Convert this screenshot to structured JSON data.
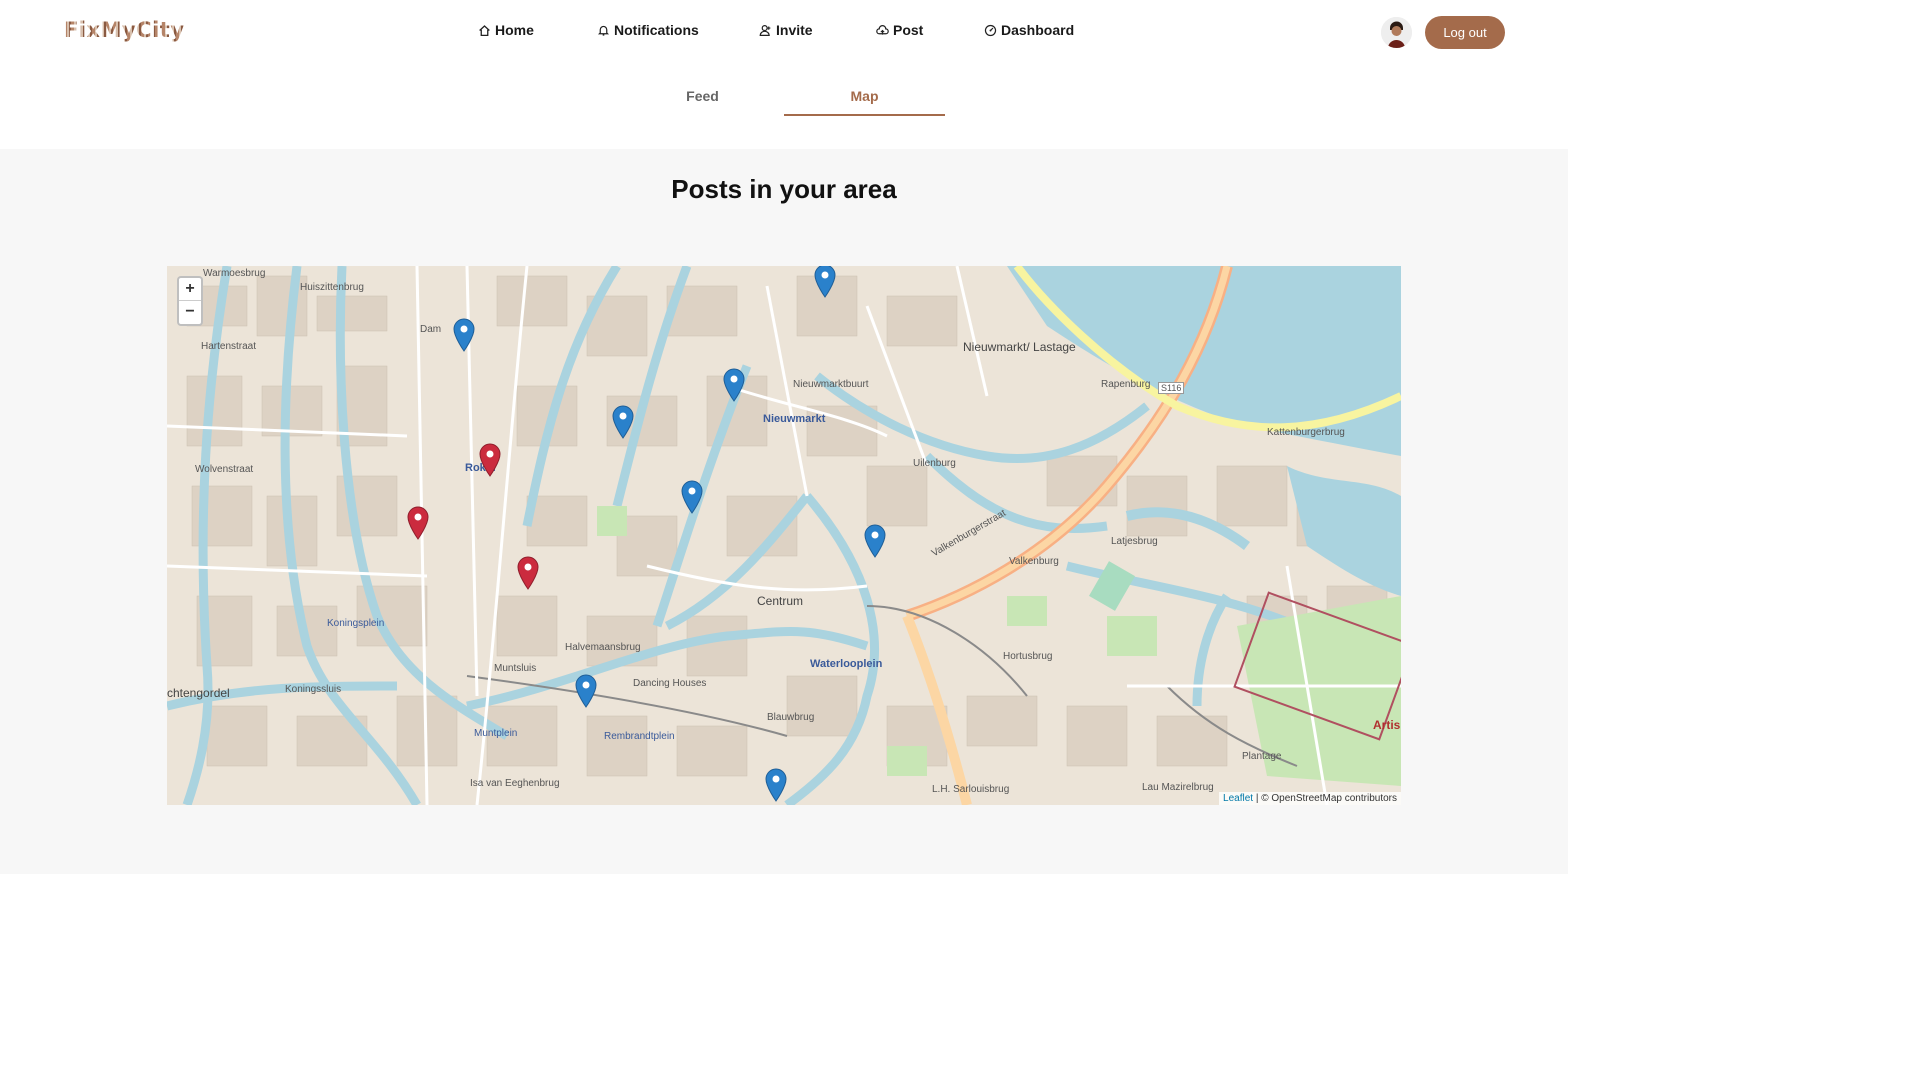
{
  "app": {
    "logo": "FixMyCity"
  },
  "nav": {
    "items": [
      {
        "label": "Home",
        "icon": "home-icon"
      },
      {
        "label": "Notifications",
        "icon": "bell-icon"
      },
      {
        "label": "Invite",
        "icon": "user-plus-icon"
      },
      {
        "label": "Post",
        "icon": "cloud-upload-icon"
      },
      {
        "label": "Dashboard",
        "icon": "dashboard-icon"
      }
    ],
    "logout": "Log out"
  },
  "tabs": {
    "feed": "Feed",
    "map": "Map",
    "active": "Map"
  },
  "main": {
    "heading": "Posts in your area"
  },
  "map": {
    "zoom_in": "+",
    "zoom_out": "−",
    "attribution_leaflet": "Leaflet",
    "attribution_rest": "| © OpenStreetMap contributors",
    "marker_colors": {
      "blue": "#2a81cb",
      "red": "#cb2b3e"
    },
    "labels": {
      "nieuwmarkt": "Nieuwmarkt/ Lastage",
      "nieuwmarktbuurt": "Nieuwmarktbuurt",
      "nieuwmarkt_square": "Nieuwmarkt",
      "rapenburg": "Rapenburg",
      "uilenburg": "Uilenburg",
      "valkenburg": "Valkenburg",
      "centrum": "Centrum",
      "waterlooplein": "Waterlooplein",
      "halvemaansbrug": "Halvemaansbrug",
      "muntsluis": "Muntsluis",
      "koningssluis": "Koningssluis",
      "kattenburgerbrug": "Kattenburgerbrug",
      "hortusbrug": "Hortusbrug",
      "rokin": "Rokin",
      "dam": "Dam",
      "muntplein": "Muntplein",
      "rembrandtplein": "Rembrandtplein",
      "blauwbrug": "Blauwbrug",
      "koningsplein": "Koningsplein",
      "artis": "Artis",
      "s116": "S116",
      "grachtengordel": "chtengordel",
      "hartenstraat": "Hartenstraat",
      "wolvenstraat": "Wolvenstraat",
      "valkenburgerstraat": "Valkenburgerstraat",
      "lau_mazirelbrug": "Lau Mazirelbrug",
      "plantage": "Plantage",
      "latjesbrug": "Latjesbrug",
      "isa_van_eeghenbrug": "Isa van Eeghenbrug",
      "lh_sarlouisbrug": "L.H. Sarlouisbrug",
      "huisstenbrug": "Huiszittenbrug",
      "warmoesbrug": "Warmoesbrug",
      "dancing_houses": "Dancing Houses"
    }
  }
}
